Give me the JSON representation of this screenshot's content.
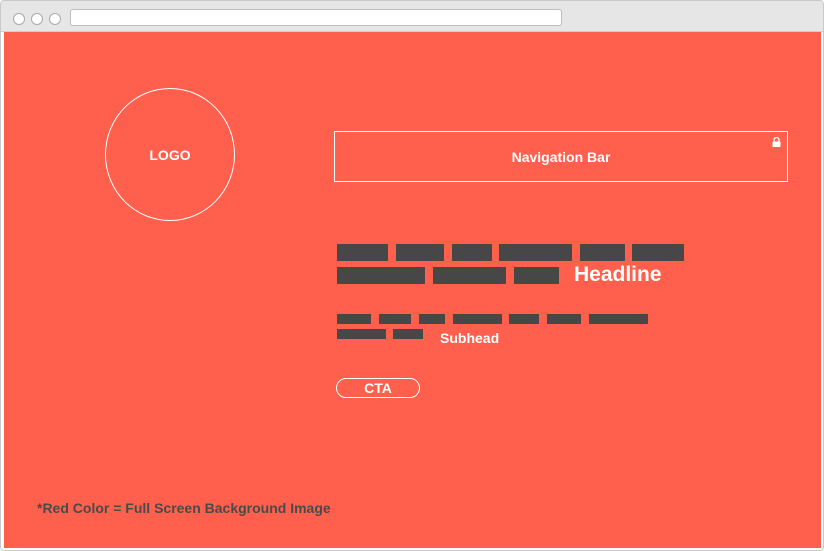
{
  "colors": {
    "background": "#ff604d",
    "placeholder_bar": "#474747",
    "text_light": "#ffffff",
    "text_dark": "#4a4a4a"
  },
  "logo": {
    "label": "LOGO"
  },
  "navigation": {
    "label": "Navigation Bar",
    "icon": "lock-icon"
  },
  "headline": {
    "label": "Headline"
  },
  "subhead": {
    "label": "Subhead"
  },
  "cta": {
    "label": "CTA"
  },
  "footnote": {
    "text": "*Red Color = Full Screen Background Image"
  }
}
